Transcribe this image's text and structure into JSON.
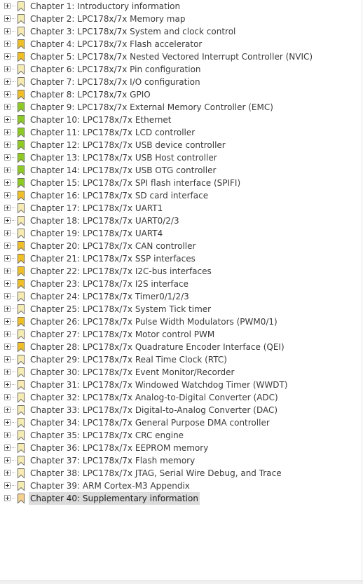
{
  "colors": {
    "bookmark_pale": "#f6ecb0",
    "bookmark_yellow": "#f2c01e",
    "bookmark_green": "#8ccc1c",
    "bookmark_orange_faded": "#f6cf88",
    "bookmark_outline": "#6a6a6a",
    "selected_row": "#dcdcdc",
    "text": "#3a3a3a"
  },
  "tree": {
    "items": [
      {
        "label": "Chapter 1: Introductory information",
        "icon": "bookmark-pale"
      },
      {
        "label": "Chapter 2: LPC178x/7x Memory map",
        "icon": "bookmark-pale"
      },
      {
        "label": "Chapter 3: LPC178x/7x System and clock control",
        "icon": "bookmark-pale"
      },
      {
        "label": "Chapter 4: LPC178x/7x Flash accelerator",
        "icon": "bookmark-yellow"
      },
      {
        "label": "Chapter 5: LPC178x/7x Nested Vectored Interrupt Controller (NVIC)",
        "icon": "bookmark-yellow"
      },
      {
        "label": "Chapter 6: LPC178x/7x Pin configuration",
        "icon": "bookmark-pale"
      },
      {
        "label": "Chapter 7: LPC178x/7x I/O configuration",
        "icon": "bookmark-pale"
      },
      {
        "label": "Chapter 8: LPC178x/7x GPIO",
        "icon": "bookmark-yellow"
      },
      {
        "label": "Chapter 9: LPC178x/7x External Memory Controller (EMC)",
        "icon": "bookmark-green"
      },
      {
        "label": "Chapter 10: LPC178x/7x Ethernet",
        "icon": "bookmark-green"
      },
      {
        "label": "Chapter 11: LPC178x/7x LCD controller",
        "icon": "bookmark-green"
      },
      {
        "label": "Chapter 12: LPC178x/7x USB device controller",
        "icon": "bookmark-green"
      },
      {
        "label": "Chapter 13: LPC178x/7x USB Host controller",
        "icon": "bookmark-green"
      },
      {
        "label": "Chapter 14: LPC178x/7x USB OTG controller",
        "icon": "bookmark-green"
      },
      {
        "label": "Chapter 15: LPC178x/7x SPI flash interface (SPIFI)",
        "icon": "bookmark-green"
      },
      {
        "label": "Chapter 16: LPC178x/7x SD card interface",
        "icon": "bookmark-yellow"
      },
      {
        "label": "Chapter 17: LPC178x/7x UART1",
        "icon": "bookmark-pale"
      },
      {
        "label": "Chapter 18: LPC178x/7x UART0/2/3",
        "icon": "bookmark-pale"
      },
      {
        "label": "Chapter 19: LPC178x/7x UART4",
        "icon": "bookmark-pale"
      },
      {
        "label": "Chapter 20: LPC178x/7x CAN controller",
        "icon": "bookmark-yellow"
      },
      {
        "label": "Chapter 21: LPC178x/7x SSP interfaces",
        "icon": "bookmark-yellow"
      },
      {
        "label": "Chapter 22: LPC178x/7x I2C-bus interfaces",
        "icon": "bookmark-yellow"
      },
      {
        "label": "Chapter 23: LPC178x/7x I2S interface",
        "icon": "bookmark-yellow"
      },
      {
        "label": "Chapter 24: LPC178x/7x Timer0/1/2/3",
        "icon": "bookmark-pale"
      },
      {
        "label": "Chapter 25: LPC178x/7x System Tick timer",
        "icon": "bookmark-pale"
      },
      {
        "label": "Chapter 26: LPC178x/7x Pulse Width Modulators (PWM0/1)",
        "icon": "bookmark-yellow"
      },
      {
        "label": "Chapter 27: LPC178x/7x Motor control PWM",
        "icon": "bookmark-pale"
      },
      {
        "label": "Chapter 28: LPC178x/7x Quadrature Encoder Interface (QEI)",
        "icon": "bookmark-yellow"
      },
      {
        "label": "Chapter 29: LPC178x/7x Real Time Clock (RTC)",
        "icon": "bookmark-pale"
      },
      {
        "label": "Chapter 30: LPC178x/7x Event Monitor/Recorder",
        "icon": "bookmark-pale"
      },
      {
        "label": "Chapter 31: LPC178x/7x Windowed Watchdog Timer (WWDT)",
        "icon": "bookmark-pale"
      },
      {
        "label": "Chapter 32: LPC178x/7x Analog-to-Digital Converter (ADC)",
        "icon": "bookmark-pale"
      },
      {
        "label": "Chapter 33: LPC178x/7x Digital-to-Analog Converter (DAC)",
        "icon": "bookmark-pale"
      },
      {
        "label": "Chapter 34: LPC178x/7x General Purpose DMA controller",
        "icon": "bookmark-pale"
      },
      {
        "label": "Chapter 35: LPC178x/7x CRC engine",
        "icon": "bookmark-pale"
      },
      {
        "label": "Chapter 36: LPC178x/7x EEPROM memory",
        "icon": "bookmark-pale"
      },
      {
        "label": "Chapter 37: LPC178x/7x Flash memory",
        "icon": "bookmark-pale"
      },
      {
        "label": "Chapter 38: LPC178x/7x JTAG, Serial Wire Debug, and Trace",
        "icon": "bookmark-pale"
      },
      {
        "label": "Chapter 39: ARM Cortex-M3 Appendix",
        "icon": "bookmark-pale"
      },
      {
        "label": "Chapter 40: Supplementary information",
        "icon": "bookmark-orange-faded",
        "selected": true
      }
    ]
  }
}
